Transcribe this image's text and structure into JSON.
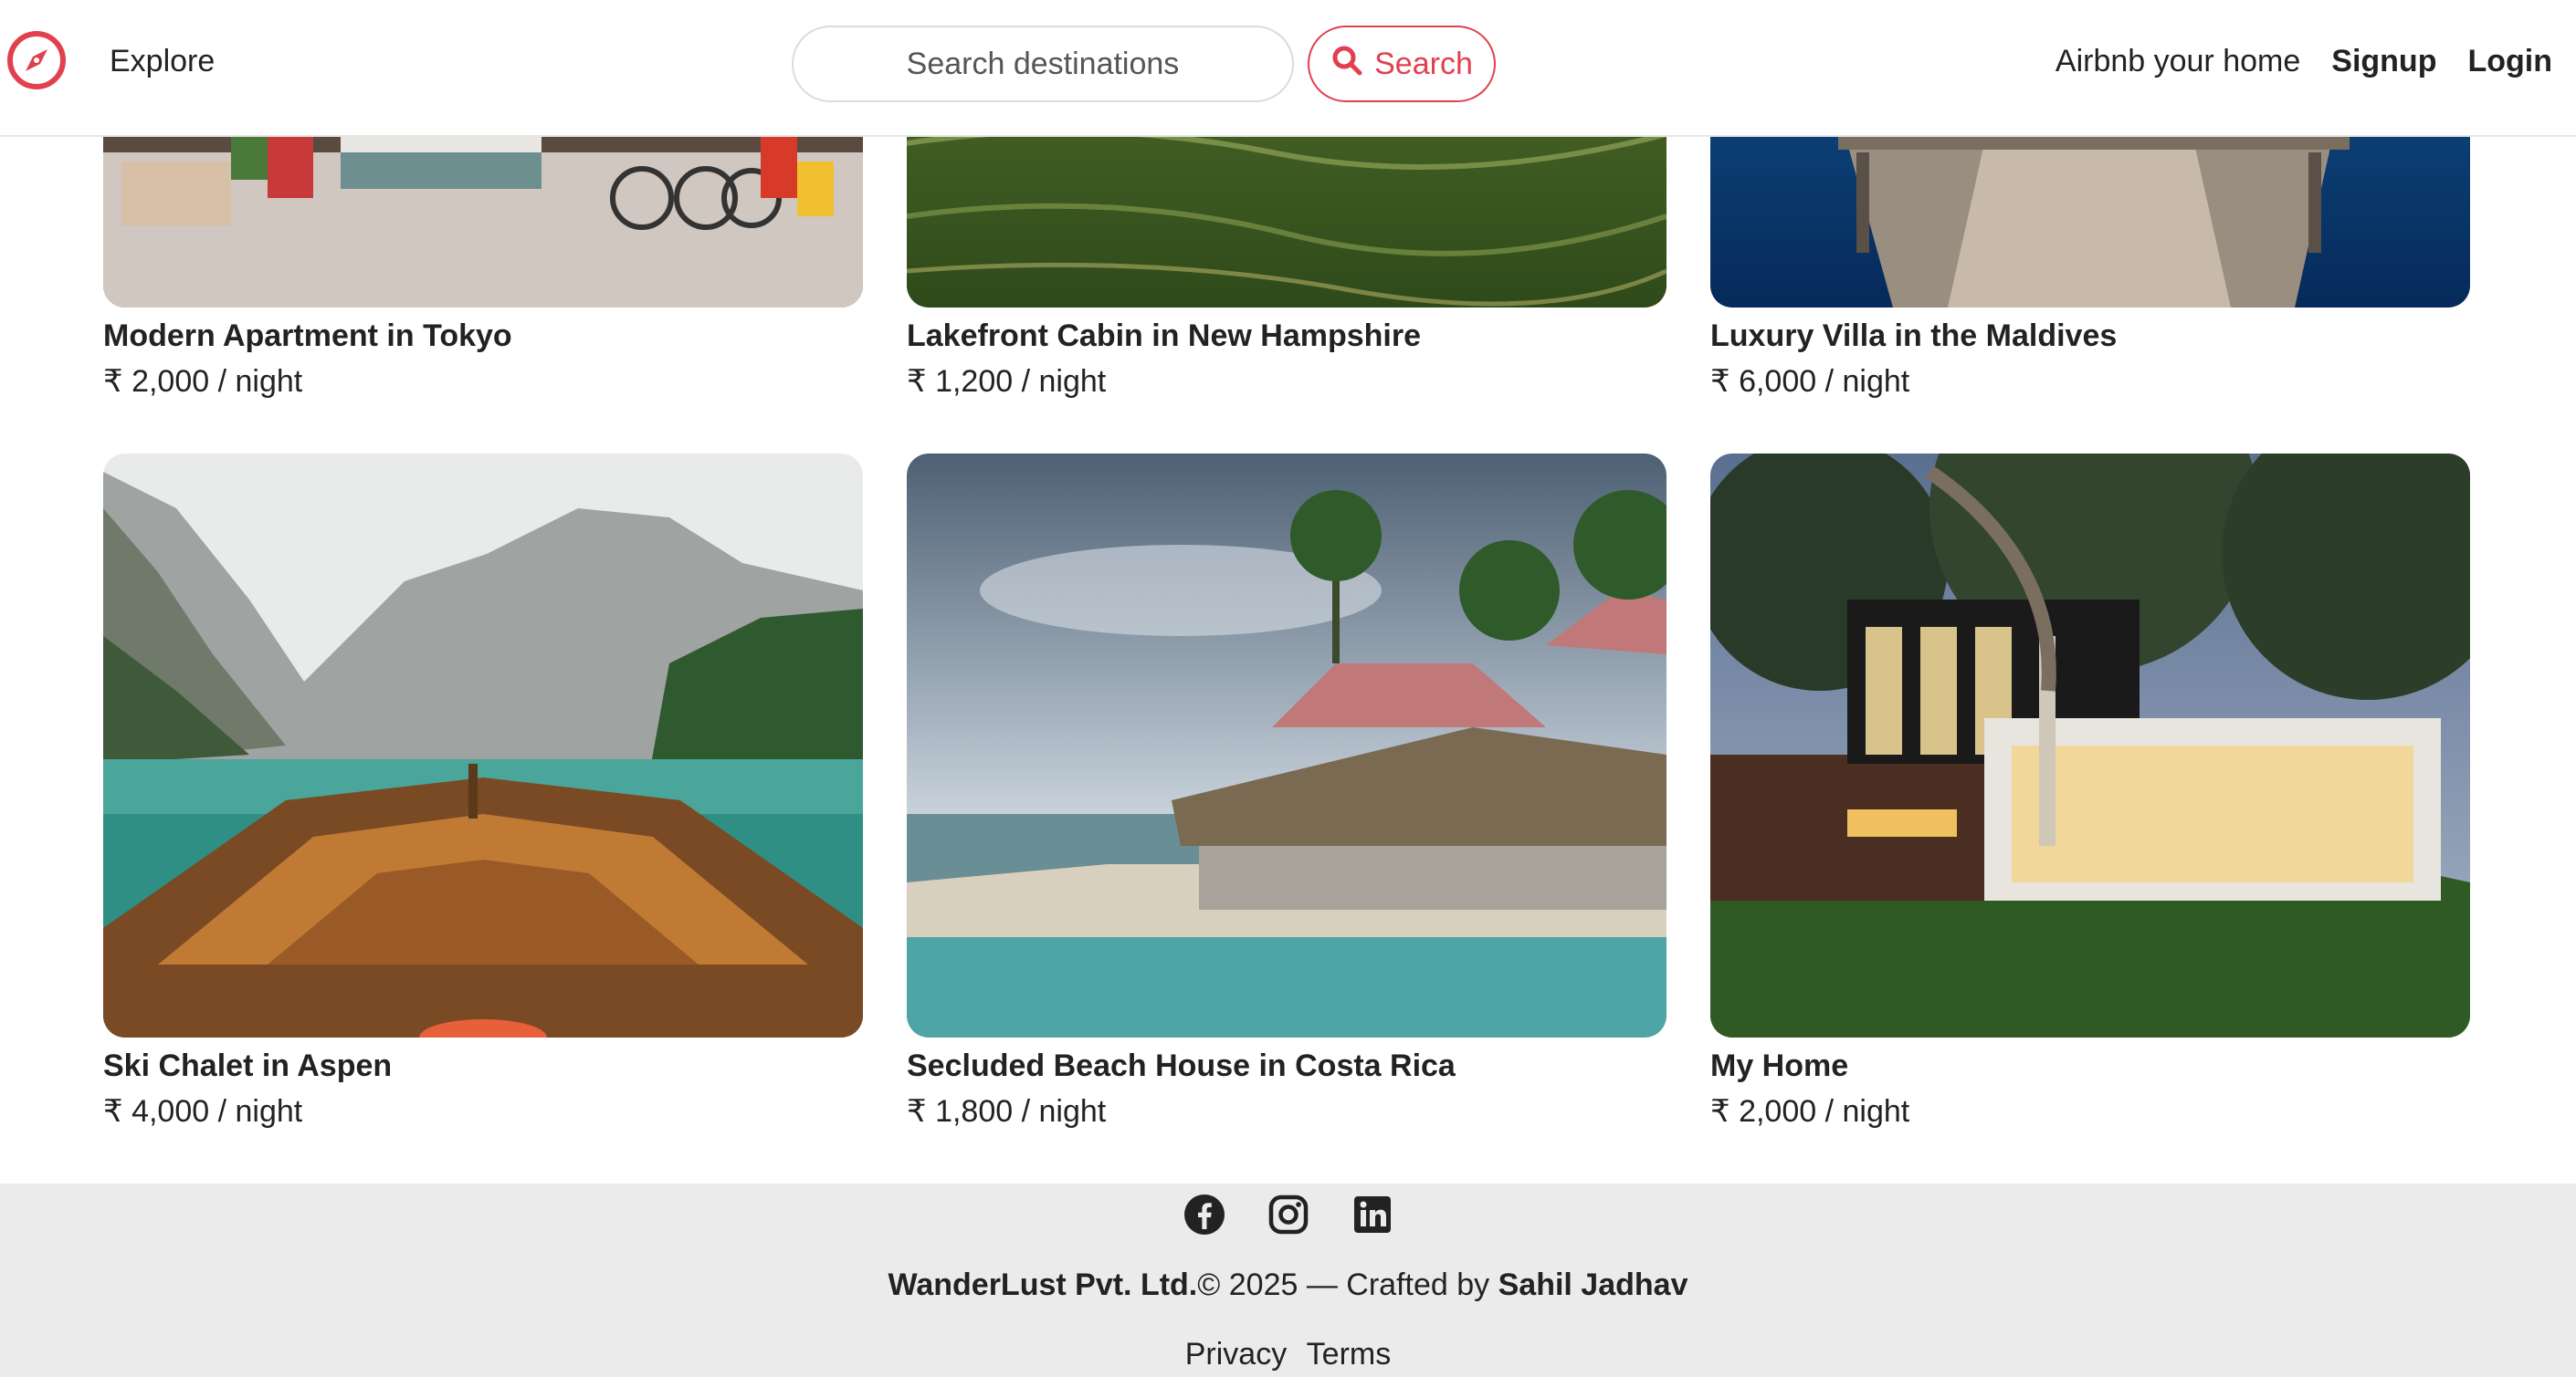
{
  "nav": {
    "explore_label": "Explore",
    "search_placeholder": "Search destinations",
    "search_button_label": "Search",
    "host_link": "Airbnb your home",
    "signup_link": "Signup",
    "login_link": "Login",
    "brand_icon": "compass-icon",
    "accent_color": "#e2404f"
  },
  "listings": [
    {
      "title": "Modern Apartment in Tokyo",
      "price": "₹ 2,000 / night"
    },
    {
      "title": "Lakefront Cabin in New Hampshire",
      "price": "₹ 1,200 / night"
    },
    {
      "title": "Luxury Villa in the Maldives",
      "price": "₹ 6,000 / night"
    },
    {
      "title": "Ski Chalet in Aspen",
      "price": "₹ 4,000 / night"
    },
    {
      "title": "Secluded Beach House in Costa Rica",
      "price": "₹ 1,800 / night"
    },
    {
      "title": "My Home",
      "price": "₹ 2,000 / night"
    }
  ],
  "footer": {
    "socials": [
      "facebook-icon",
      "instagram-icon",
      "linkedin-icon"
    ],
    "company": "WanderLust Pvt. Ltd.",
    "copyright": "© 2025 — Crafted by",
    "author": "Sahil Jadhav",
    "privacy_link": "Privacy",
    "terms_link": "Terms"
  }
}
